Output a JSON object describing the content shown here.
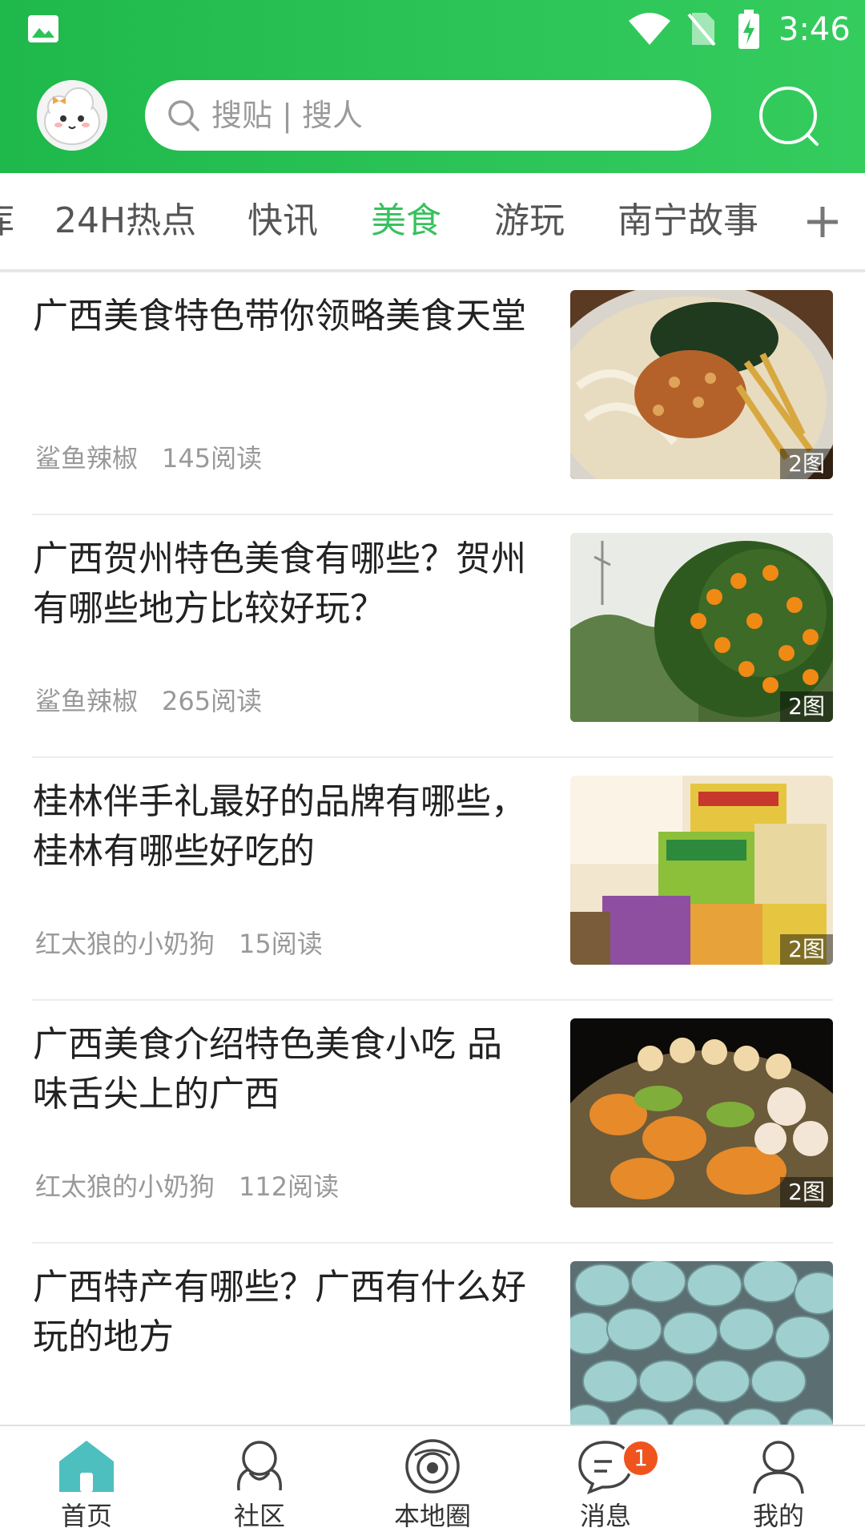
{
  "status_bar": {
    "time": "3:46"
  },
  "header": {
    "search_placeholder": "搜贴 | 搜人"
  },
  "tabs": {
    "items": [
      "24H热点",
      "快讯",
      "美食",
      "游玩",
      "南宁故事"
    ],
    "partial_left": "库",
    "active_index": 2,
    "active_color": "#37c15e"
  },
  "feed": [
    {
      "title": "广西美食特色带你领略美食天堂",
      "author": "鲨鱼辣椒",
      "reads": "145阅读",
      "image_count": "2图"
    },
    {
      "title": "广西贺州特色美食有哪些？贺州有哪些地方比较好玩？",
      "author": "鲨鱼辣椒",
      "reads": "265阅读",
      "image_count": "2图"
    },
    {
      "title": "桂林伴手礼最好的品牌有哪些，桂林有哪些好吃的",
      "author": "红太狼的小奶狗",
      "reads": "15阅读",
      "image_count": "2图"
    },
    {
      "title": "广西美食介绍特色美食小吃 品味舌尖上的广西",
      "author": "红太狼的小奶狗",
      "reads": "112阅读",
      "image_count": "2图"
    },
    {
      "title": "广西特产有哪些？广西有什么好玩的地方",
      "author": "",
      "reads": "",
      "image_count": ""
    }
  ],
  "bottom_nav": {
    "items": [
      {
        "label": "首页",
        "active": true
      },
      {
        "label": "社区"
      },
      {
        "label": "本地圈"
      },
      {
        "label": "消息",
        "badge": "1"
      },
      {
        "label": "我的"
      }
    ]
  },
  "colors": {
    "brand_green": "#2cc457",
    "accent_teal": "#4dbfbf",
    "badge_orange": "#f0541e"
  }
}
